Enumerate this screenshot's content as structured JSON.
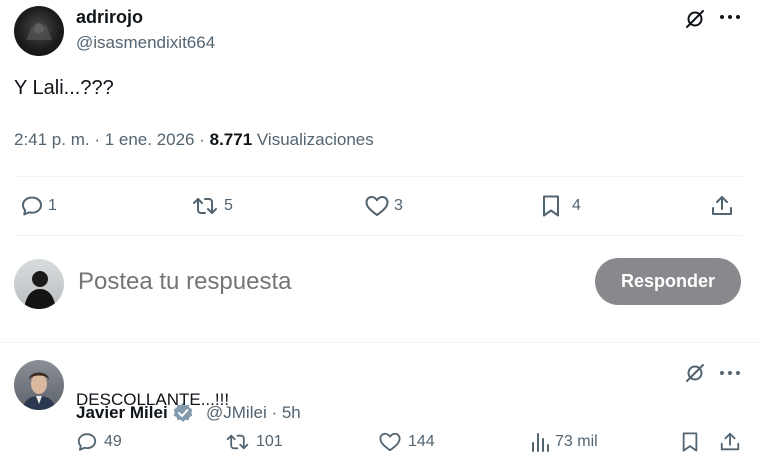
{
  "tweet": {
    "display_name": "adrirojo",
    "handle": "@isasmendixit664",
    "text": "Y Lali...???",
    "time_date": "2:41 p. m. · 1 ene. 2026 · ",
    "views_count": "8.771",
    "views_label": " Visualizaciones",
    "actions": {
      "reply_count": "1",
      "retweet_count": "5",
      "like_count": "3",
      "bookmark_count": "4"
    }
  },
  "composer": {
    "placeholder": "Postea tu respuesta",
    "button_label": "Responder"
  },
  "reply": {
    "display_name": "Javier Milei",
    "handle": "@JMilei",
    "separator": " · ",
    "time": "5h",
    "text": "DESCOLLANTE...!!!",
    "actions": {
      "reply_count": "49",
      "retweet_count": "101",
      "like_count": "144",
      "views_count": "73 mil"
    }
  },
  "colors": {
    "text_primary": "#0f1419",
    "text_secondary": "#536471",
    "verified": "#829aab",
    "button_bg": "#87898c",
    "divider": "#eff3f4"
  },
  "icons": [
    "grok-icon",
    "more-icon",
    "reply-icon",
    "retweet-icon",
    "like-icon",
    "bookmark-icon",
    "share-icon",
    "views-icon",
    "verified-badge-icon"
  ]
}
